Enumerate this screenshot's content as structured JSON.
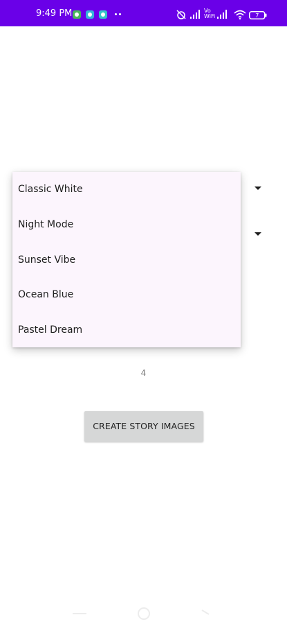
{
  "status_bar": {
    "time": "9:49 PM",
    "volte_label": "Vo\nWiFi",
    "battery_level": "7",
    "colors": {
      "background": "#6a00e8"
    },
    "icons": {
      "notifications": [
        "app-notification-icon",
        "settings-notification-icon",
        "settings-notification-icon"
      ],
      "right": [
        "alarm-off-icon",
        "signal-icon",
        "volte-icon",
        "signal-icon",
        "wifi-icon",
        "battery-icon"
      ]
    }
  },
  "theme_menu": {
    "items": [
      {
        "label": "Classic White"
      },
      {
        "label": "Night Mode"
      },
      {
        "label": "Sunset Vibe"
      },
      {
        "label": "Ocean Blue"
      },
      {
        "label": "Pastel Dream"
      }
    ],
    "colors": {
      "background": "#fcf5fd"
    }
  },
  "form": {
    "number_value": "4",
    "create_button_label": "CREATE STORY IMAGES"
  },
  "nav_bar": {
    "icons": [
      "back-icon",
      "home-icon",
      "recents-icon"
    ]
  }
}
